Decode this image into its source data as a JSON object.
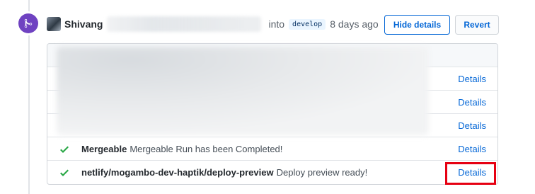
{
  "event": {
    "username": "Shivang",
    "into_label": "into",
    "branch": "develop",
    "time_ago": "8 days ago"
  },
  "buttons": {
    "hide_details": "Hide details",
    "revert": "Revert"
  },
  "checks": {
    "redacted_rows": [
      {
        "details_label": "Details"
      },
      {
        "details_label": "Details"
      },
      {
        "details_label": "Details"
      }
    ],
    "rows": [
      {
        "status": "success",
        "name": "Mergeable",
        "description": "Mergeable Run has been Completed!",
        "details_label": "Details"
      },
      {
        "status": "success",
        "name": "netlify/mogambo-dev-haptik/deploy-preview",
        "description": "Deploy preview ready!",
        "details_label": "Details"
      }
    ]
  },
  "colors": {
    "merged_purple": "#6f42c1",
    "link_blue": "#0366d6",
    "success_green": "#28a745",
    "highlight_red": "#e60012"
  },
  "icons": {
    "merge": "git-merge-icon",
    "check": "check-icon"
  }
}
